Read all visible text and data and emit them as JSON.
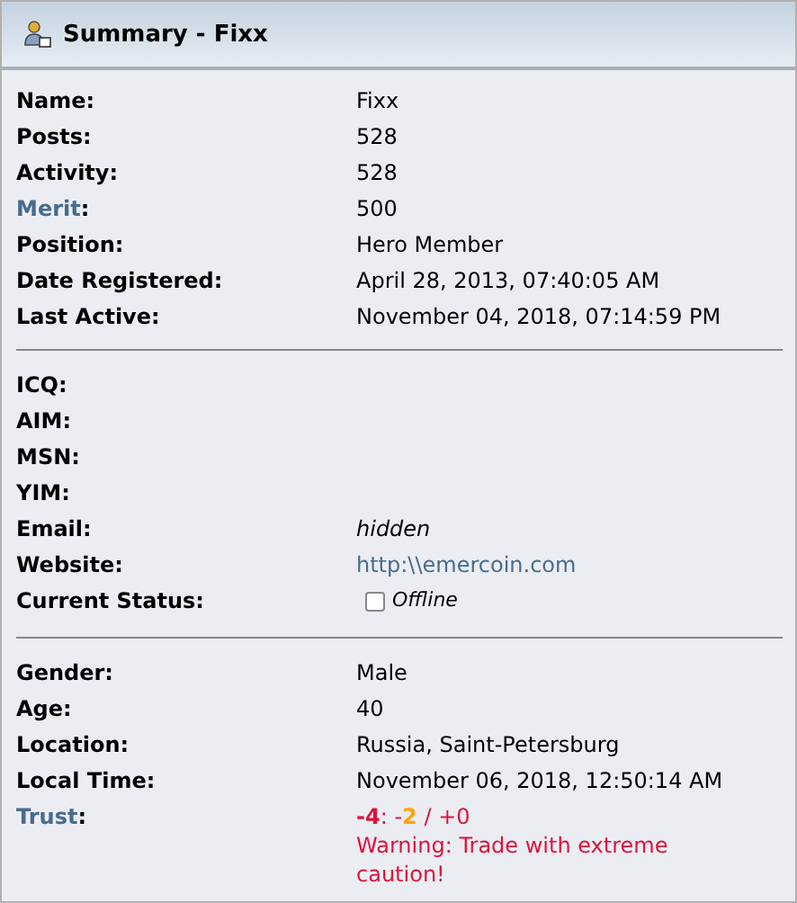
{
  "header": {
    "title": "Summary - Fixx"
  },
  "sections": [
    {
      "rows": [
        {
          "label": "Name",
          "kind": "text",
          "value": "Fixx"
        },
        {
          "label": "Posts",
          "kind": "text",
          "value": "528"
        },
        {
          "label": "Activity",
          "kind": "text",
          "value": "528"
        },
        {
          "label": "Merit",
          "label_link": true,
          "kind": "text",
          "value": "500"
        },
        {
          "label": "Position",
          "kind": "text",
          "value": "Hero Member"
        },
        {
          "label": "Date Registered",
          "kind": "text",
          "value": "April 28, 2013, 07:40:05 AM"
        },
        {
          "label": "Last Active",
          "kind": "text",
          "value": "November 04, 2018, 07:14:59 PM"
        }
      ]
    },
    {
      "rows": [
        {
          "label": "ICQ",
          "kind": "empty"
        },
        {
          "label": "AIM",
          "kind": "empty"
        },
        {
          "label": "MSN",
          "kind": "empty"
        },
        {
          "label": "YIM",
          "kind": "empty"
        },
        {
          "label": "Email",
          "kind": "italic",
          "value": "hidden"
        },
        {
          "label": "Website",
          "kind": "link",
          "value": "http:\\\\emercoin.com"
        },
        {
          "label": "Current Status",
          "kind": "status",
          "value": "Offline",
          "online": false
        }
      ]
    },
    {
      "rows": [
        {
          "label": "Gender",
          "kind": "text",
          "value": "Male"
        },
        {
          "label": "Age",
          "kind": "text",
          "value": "40"
        },
        {
          "label": "Location",
          "kind": "text",
          "value": "Russia, Saint-Petersburg"
        },
        {
          "label": "Local Time",
          "kind": "text",
          "value": "November 06, 2018, 12:50:14 AM"
        },
        {
          "label": "Trust",
          "label_link": true,
          "kind": "trust",
          "score_parts": [
            {
              "text": "**-4**",
              "color": "#dc143c"
            },
            {
              "text": ": -",
              "color": "#dc143c"
            },
            {
              "text": "**2**",
              "color": "#ffa500"
            },
            {
              "text": " / +0",
              "color": "#dc143c"
            }
          ],
          "value": "Warning: Trade with extreme caution!"
        }
      ]
    }
  ],
  "label_suffix": ":"
}
